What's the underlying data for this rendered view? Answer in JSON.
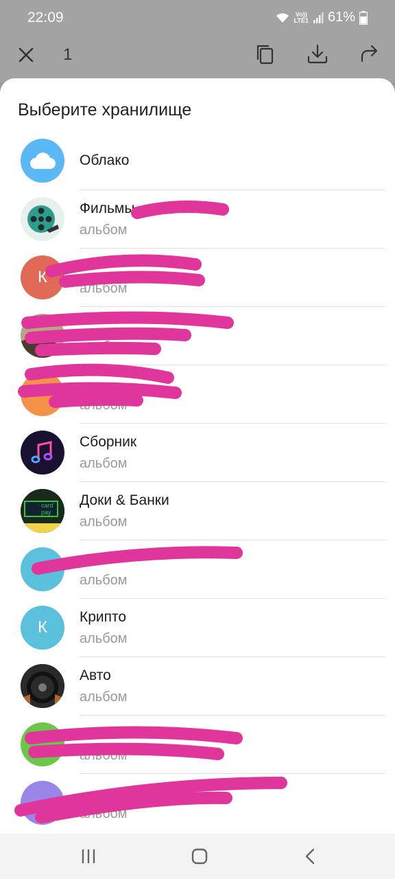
{
  "status_bar": {
    "time": "22:09",
    "network": "Vo))\nLTE1",
    "battery": "61%"
  },
  "selection_bar": {
    "count": "1",
    "icons": [
      "close-icon",
      "copy-icon",
      "download-icon",
      "share-icon"
    ]
  },
  "sheet": {
    "title": "Выберите хранилище",
    "items": [
      {
        "title": "Облако",
        "subtitle": "",
        "avatar": "cloud",
        "color": "#5cb8f5"
      },
      {
        "title": "Фильмы",
        "subtitle": "альбом",
        "avatar": "film",
        "color": "#e8f0ee"
      },
      {
        "title": "",
        "subtitle": "альбом",
        "avatar": "К",
        "color": "#e06a56"
      },
      {
        "title": "",
        "subtitle": "альбом",
        "avatar": "photo",
        "color": "#c8b8a0"
      },
      {
        "title": "",
        "subtitle": "альбом",
        "avatar": "",
        "color": "#f4924a"
      },
      {
        "title": "Сборник",
        "subtitle": "альбом",
        "avatar": "music",
        "color": "#1a1030"
      },
      {
        "title": "Доки & Банки",
        "subtitle": "альбом",
        "avatar": "card",
        "color": "#1f3a20"
      },
      {
        "title": "",
        "subtitle": "альбом",
        "avatar": "",
        "color": "#5bc0db"
      },
      {
        "title": "Крипто",
        "subtitle": "альбом",
        "avatar": "К",
        "color": "#5bc0db"
      },
      {
        "title": "Авто",
        "subtitle": "альбом",
        "avatar": "wheel",
        "color": "#3a3a3a"
      },
      {
        "title": "",
        "subtitle": "альбом",
        "avatar": "",
        "color": "#6cc64a"
      },
      {
        "title": "",
        "subtitle": "альбом",
        "avatar": "",
        "color": "#9a86e8"
      }
    ]
  },
  "card_logo_text": "card pay",
  "nav_icons": [
    "recent-apps-icon",
    "home-icon",
    "back-icon"
  ]
}
